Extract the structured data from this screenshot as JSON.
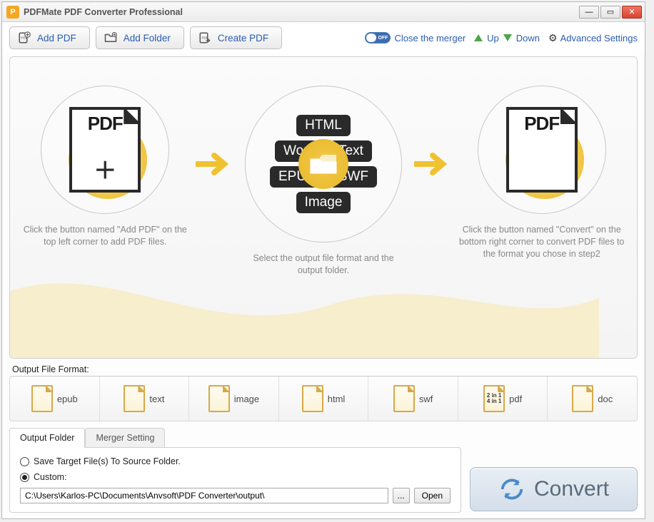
{
  "titlebar": {
    "title": "PDFMate PDF Converter Professional",
    "app_icon_letter": "P"
  },
  "toolbar": {
    "add_pdf": "Add PDF",
    "add_folder": "Add Folder",
    "create_pdf": "Create PDF",
    "close_merger": "Close the merger",
    "up": "Up",
    "down": "Down",
    "advanced": "Advanced Settings",
    "toggle_state": "OFF"
  },
  "steps": {
    "s1_pdf_label": "PDF",
    "s1_caption": "Click the button named \"Add PDF\" on the top left corner to add PDF files.",
    "s2_formats": {
      "html": "HTML",
      "word": "Word",
      "text": "Text",
      "epub": "EPUB",
      "swf": "SWF",
      "image": "Image"
    },
    "s2_caption": "Select the output file format and the output folder.",
    "s3_pdf_label": "PDF",
    "s3_caption": "Click the button named \"Convert\" on the bottom right corner to convert PDF files to the format you chose in step2"
  },
  "output_format": {
    "label": "Output File Format:",
    "items": [
      {
        "name": "epub"
      },
      {
        "name": "text"
      },
      {
        "name": "image"
      },
      {
        "name": "html"
      },
      {
        "name": "swf"
      },
      {
        "name": "pdf",
        "sub": "2 in 1\n4 in 1"
      },
      {
        "name": "doc"
      }
    ]
  },
  "tabs": {
    "output_folder": "Output Folder",
    "merger_setting": "Merger Setting"
  },
  "output_panel": {
    "save_source": "Save Target File(s) To Source Folder.",
    "custom": "Custom:",
    "path": "C:\\Users\\Karlos-PC\\Documents\\Anvsoft\\PDF Converter\\output\\",
    "browse": "...",
    "open": "Open"
  },
  "convert": {
    "label": "Convert"
  }
}
